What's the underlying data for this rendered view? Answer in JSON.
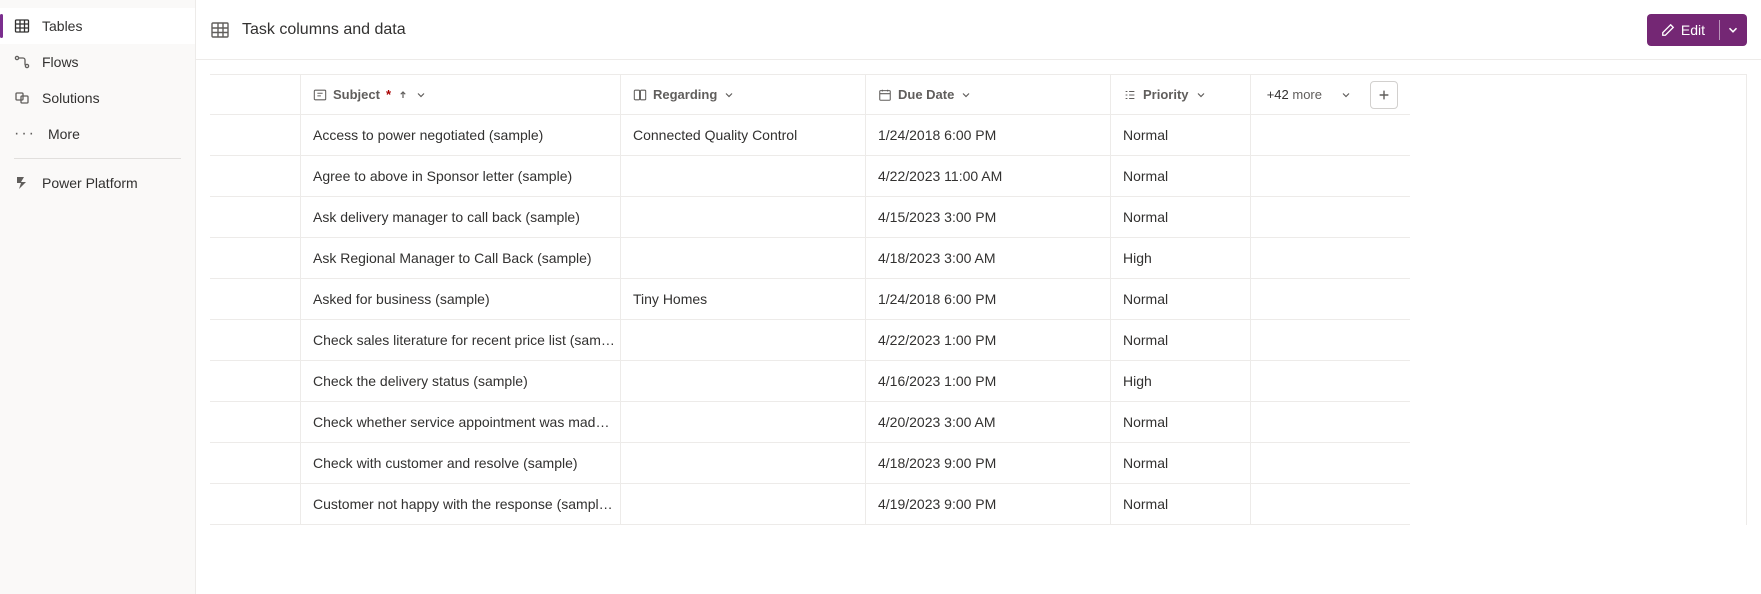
{
  "sidebar": {
    "items": [
      {
        "label": "Tables",
        "icon": "table-icon",
        "selected": true
      },
      {
        "label": "Flows",
        "icon": "flow-icon",
        "selected": false
      },
      {
        "label": "Solutions",
        "icon": "solutions-icon",
        "selected": false
      },
      {
        "label": "More",
        "icon": "more-icon",
        "selected": false
      }
    ],
    "external": {
      "label": "Power Platform",
      "icon": "power-platform-icon"
    }
  },
  "header": {
    "title": "Task columns and data",
    "edit_label": "Edit"
  },
  "columns": {
    "subject_label": "Subject",
    "subject_required": "*",
    "regarding_label": "Regarding",
    "due_label": "Due Date",
    "priority_label": "Priority",
    "more_text": "more",
    "more_count": "+42"
  },
  "rows": [
    {
      "subject": "Access to power negotiated (sample)",
      "regarding": "Connected Quality Control",
      "due": "1/24/2018 6:00 PM",
      "priority": "Normal"
    },
    {
      "subject": "Agree to above in Sponsor letter (sample)",
      "regarding": "",
      "due": "4/22/2023 11:00 AM",
      "priority": "Normal"
    },
    {
      "subject": "Ask delivery manager to call back (sample)",
      "regarding": "",
      "due": "4/15/2023 3:00 PM",
      "priority": "Normal"
    },
    {
      "subject": "Ask Regional Manager to Call Back (sample)",
      "regarding": "",
      "due": "4/18/2023 3:00 AM",
      "priority": "High"
    },
    {
      "subject": "Asked for business (sample)",
      "regarding": "Tiny Homes",
      "due": "1/24/2018 6:00 PM",
      "priority": "Normal"
    },
    {
      "subject": "Check sales literature for recent price list (sam…",
      "regarding": "",
      "due": "4/22/2023 1:00 PM",
      "priority": "Normal"
    },
    {
      "subject": "Check the delivery status (sample)",
      "regarding": "",
      "due": "4/16/2023 1:00 PM",
      "priority": "High"
    },
    {
      "subject": "Check whether service appointment was mad…",
      "regarding": "",
      "due": "4/20/2023 3:00 AM",
      "priority": "Normal"
    },
    {
      "subject": "Check with customer and resolve (sample)",
      "regarding": "",
      "due": "4/18/2023 9:00 PM",
      "priority": "Normal"
    },
    {
      "subject": "Customer not happy with the response (sampl…",
      "regarding": "",
      "due": "4/19/2023 9:00 PM",
      "priority": "Normal"
    }
  ]
}
